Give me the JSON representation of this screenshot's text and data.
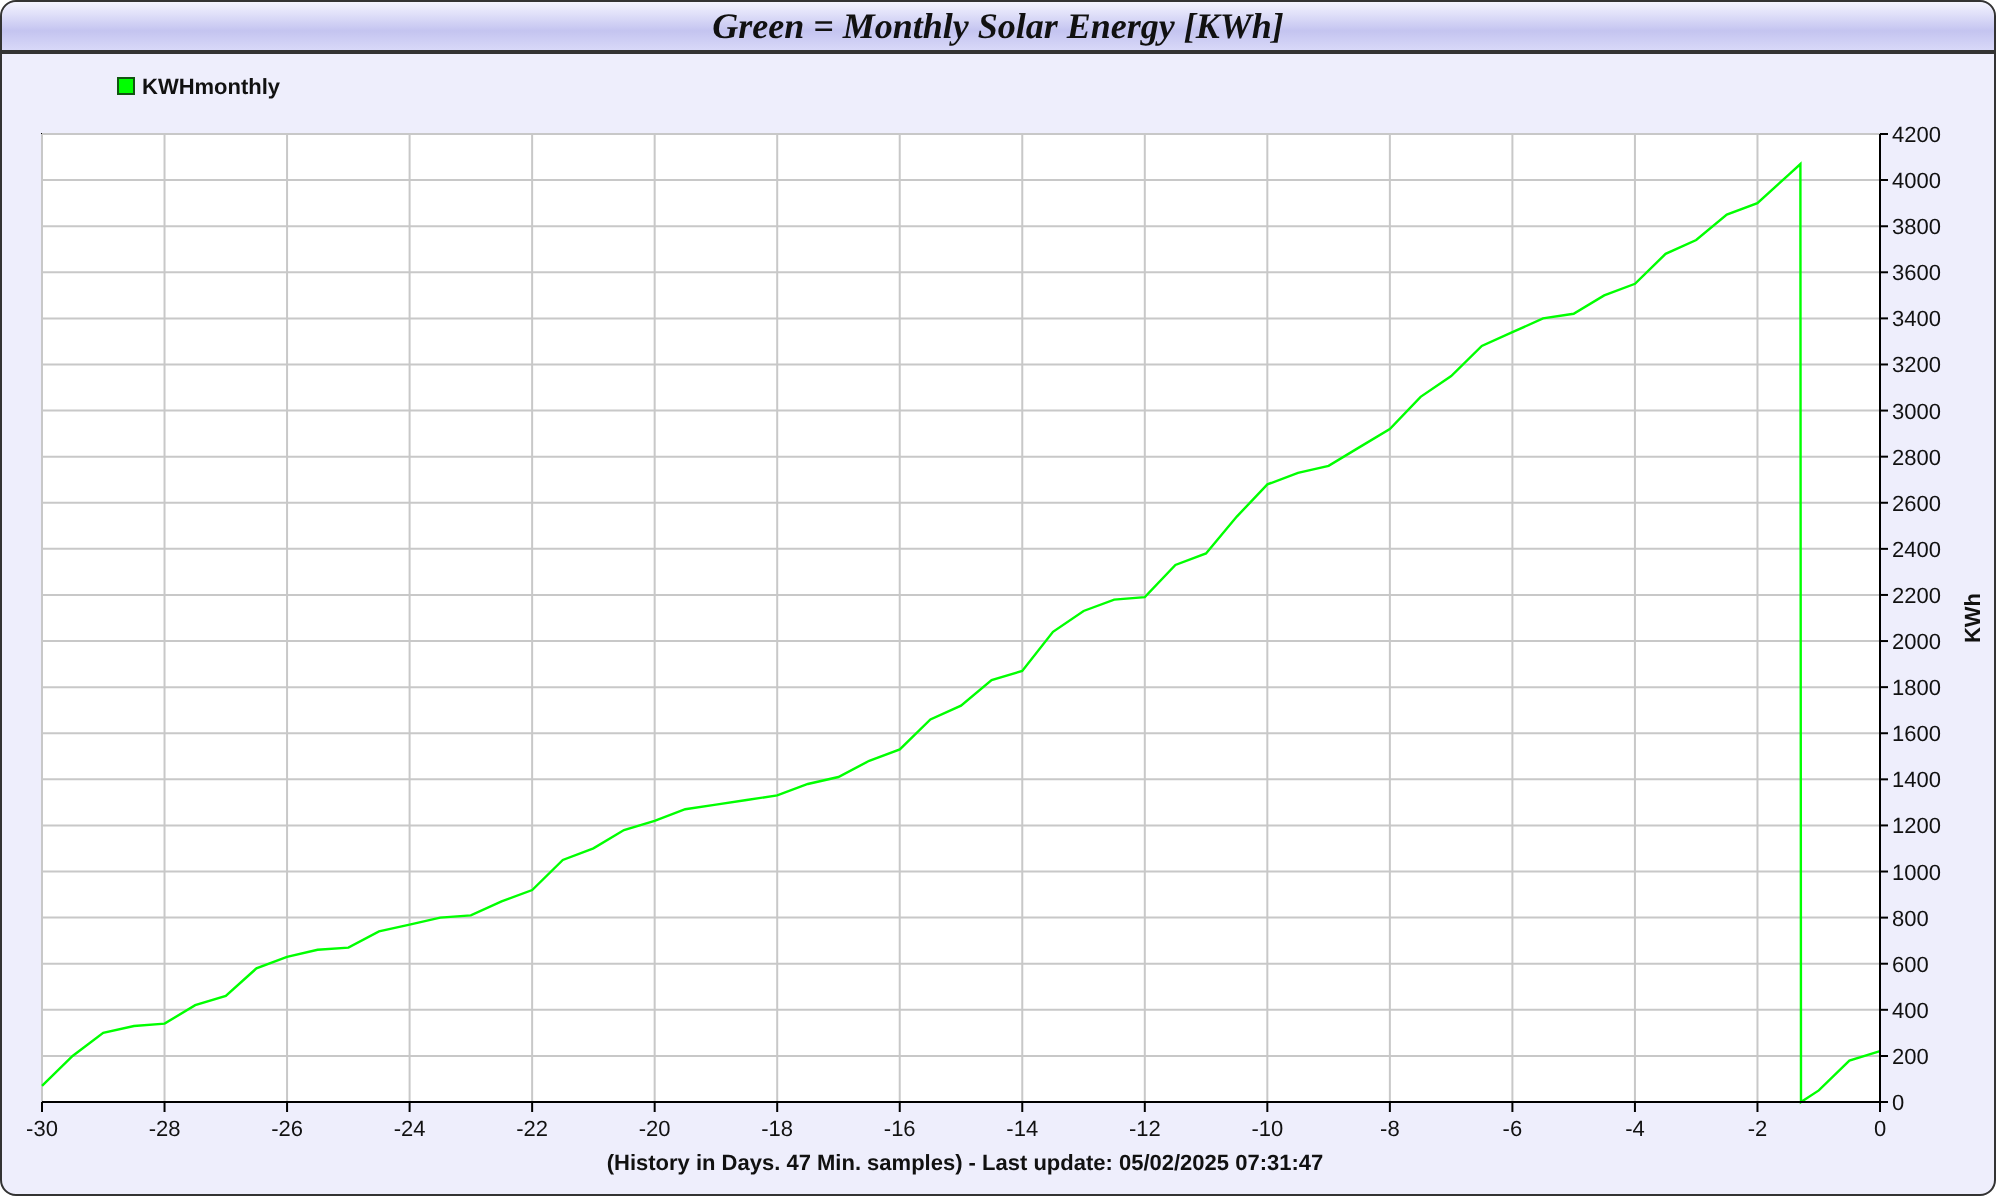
{
  "window": {
    "title": "Green = Monthly Solar Energy [KWh]"
  },
  "chart": {
    "chart_data": {
      "type": "line",
      "xlabel": "(History in Days. 47 Min. samples) - Last update: 05/02/2025 07:31:47",
      "ylabel": "KWh",
      "x": [
        -30,
        -29.5,
        -29,
        -28.5,
        -28,
        -27.5,
        -27,
        -26.5,
        -26,
        -25.5,
        -25,
        -24.5,
        -24,
        -23.5,
        -23,
        -22.5,
        -22,
        -21.5,
        -21,
        -20.5,
        -20,
        -19.5,
        -19,
        -18.5,
        -18,
        -17.5,
        -17,
        -16.5,
        -16,
        -15.5,
        -15,
        -14.5,
        -14,
        -13.5,
        -13,
        -12.5,
        -12,
        -11.5,
        -11,
        -10.5,
        -10,
        -9.5,
        -9,
        -8.5,
        -8,
        -7.5,
        -7,
        -6.5,
        -6,
        -5.5,
        -5,
        -4.5,
        -4,
        -3.5,
        -3,
        -2.5,
        -2,
        -1.5,
        -1.3,
        -1.29,
        -1,
        -0.5,
        0
      ],
      "series": [
        {
          "name": "KWHmonthly",
          "color": "#00ff00",
          "values": [
            70,
            200,
            300,
            330,
            340,
            420,
            460,
            580,
            630,
            660,
            670,
            740,
            770,
            800,
            810,
            870,
            920,
            1050,
            1100,
            1180,
            1220,
            1270,
            1290,
            1310,
            1330,
            1380,
            1410,
            1480,
            1530,
            1660,
            1720,
            1830,
            1870,
            2040,
            2130,
            2180,
            2190,
            2330,
            2380,
            2540,
            2680,
            2730,
            2760,
            2840,
            2920,
            3060,
            3150,
            3280,
            3340,
            3400,
            3420,
            3500,
            3550,
            3680,
            3740,
            3850,
            3900,
            4020,
            4070,
            0,
            50,
            180,
            220
          ]
        }
      ],
      "grid": true,
      "xlim": [
        -30,
        0
      ],
      "ylim": [
        0,
        4200
      ],
      "xticks": [
        -30,
        -28,
        -26,
        -24,
        -22,
        -20,
        -18,
        -16,
        -14,
        -12,
        -10,
        -8,
        -6,
        -4,
        -2,
        0
      ],
      "yticks": [
        0,
        200,
        400,
        600,
        800,
        1000,
        1200,
        1400,
        1600,
        1800,
        2000,
        2200,
        2400,
        2600,
        2800,
        3000,
        3200,
        3400,
        3600,
        3800,
        4000,
        4200
      ]
    }
  }
}
